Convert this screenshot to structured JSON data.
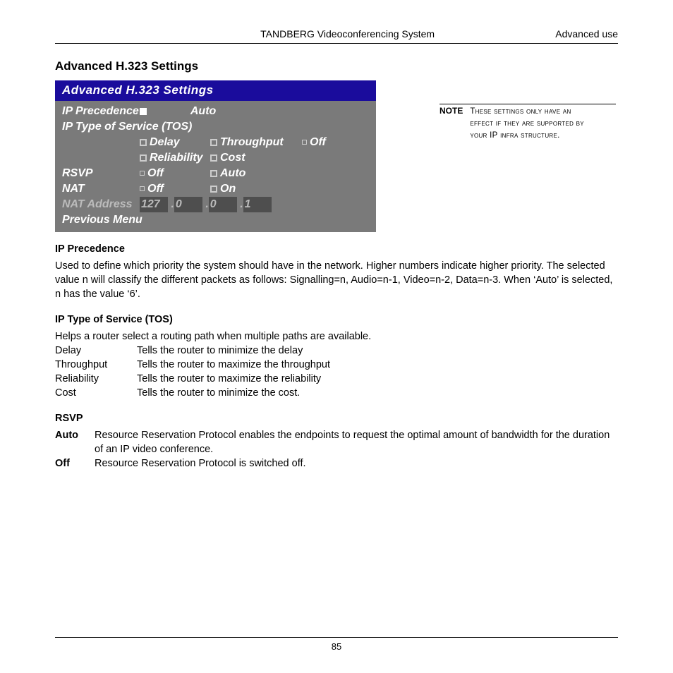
{
  "header": {
    "left": "TANDBERG Videoconferencing System",
    "right": "Advanced use"
  },
  "page_heading": "Advanced H.323 Settings",
  "panel": {
    "title": "Advanced H.323 Settings",
    "ip_precedence_label": "IP Precedence",
    "ip_precedence_auto": "Auto",
    "ip_tos_label": "IP Type of Service (TOS)",
    "tos_delay": "Delay",
    "tos_throughput": "Throughput",
    "tos_off": "Off",
    "tos_reliability": "Reliability",
    "tos_cost": "Cost",
    "rsvp_label": "RSVP",
    "rsvp_off": "Off",
    "rsvp_auto": "Auto",
    "nat_label": "NAT",
    "nat_off": "Off",
    "nat_on": "On",
    "nat_addr_label": "NAT Address",
    "nat_addr": {
      "a": "127",
      "b": "0",
      "c": "0",
      "d": "1"
    },
    "prev_menu": "Previous Menu"
  },
  "note": {
    "label": "NOTE",
    "line1": "These settings only have an",
    "line2_pre": "effect if they are supported by",
    "line3_pre": "your ",
    "line3_ip": "IP",
    "line3_post": " infra structure."
  },
  "sections": {
    "ipp_heading": "IP  Precedence",
    "ipp_para": "Used to define which priority the system should have in the network. Higher numbers indicate higher priority. The selected value n will classify the different packets as follows: Signalling=n, Audio=n-1, Video=n-2, Data=n-3. When ‘Auto’ is selected, n has the value ‘6’.",
    "tos_heading": "IP Type of Service (TOS)",
    "tos_intro": "Helps a router select a routing path when multiple paths are available.",
    "tos_items": [
      {
        "k": "Delay",
        "v": "Tells the router to minimize the delay"
      },
      {
        "k": "Throughput",
        "v": "Tells the router to maximize the throughput"
      },
      {
        "k": "Reliability",
        "v": "Tells the router to maximize the reliability"
      },
      {
        "k": "Cost",
        "v": "Tells the router to minimize the cost."
      }
    ],
    "rsvp_heading": "RSVP",
    "rsvp_items": [
      {
        "k": "Auto",
        "v": "Resource Reservation Protocol enables the endpoints to request the optimal amount of bandwidth for the duration of an IP video conference."
      },
      {
        "k": "Off",
        "v": "Resource Reservation Protocol is switched off."
      }
    ]
  },
  "footer": {
    "page_num": "85"
  }
}
